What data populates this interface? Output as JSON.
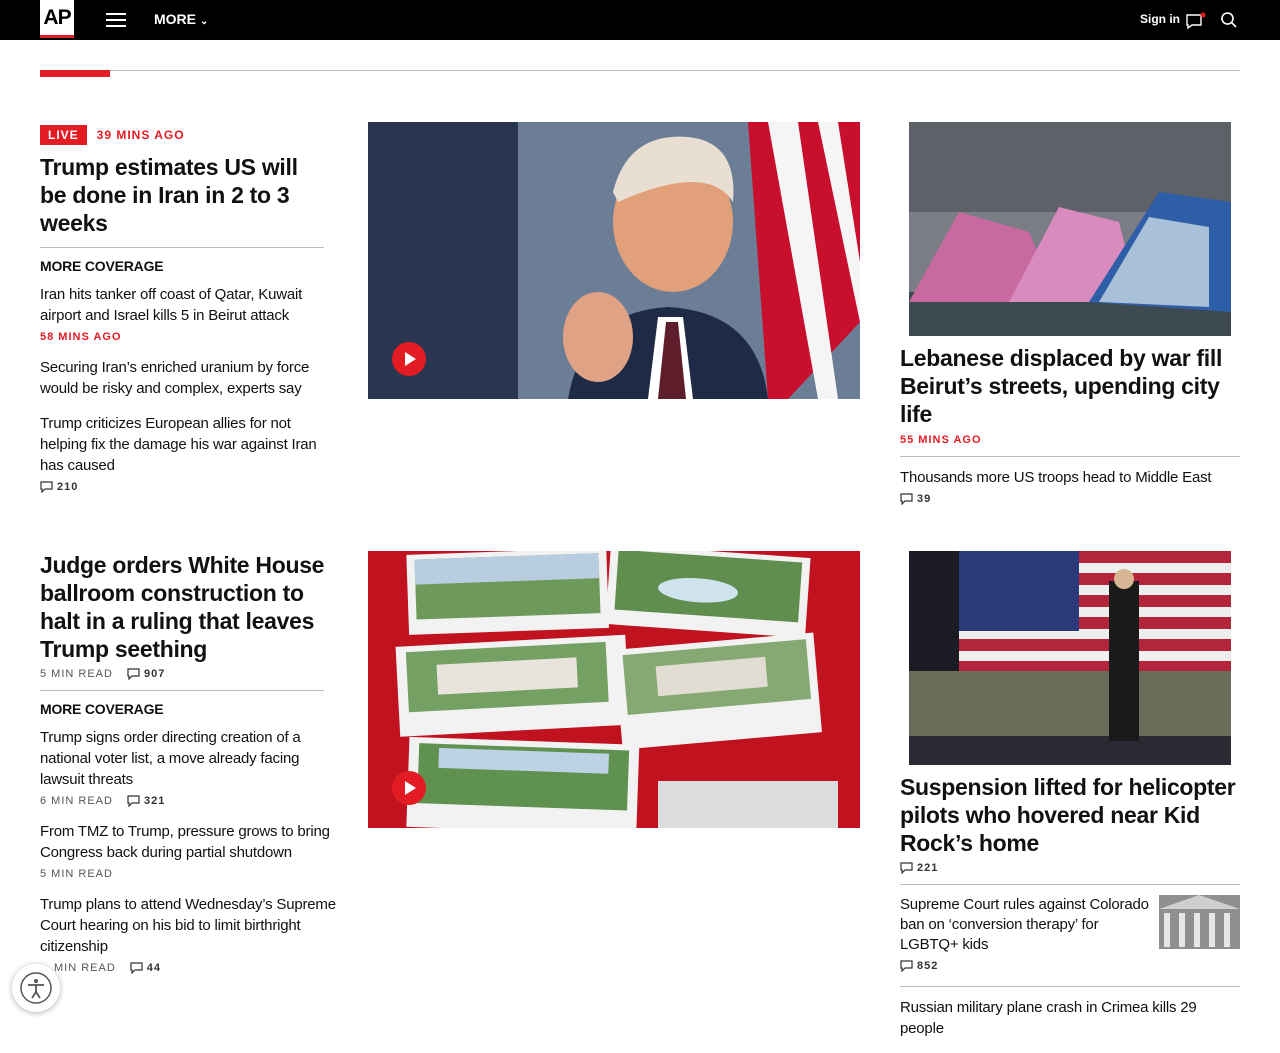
{
  "header": {
    "logo": "AP",
    "more_label": "MORE",
    "signin_label": "Sign in"
  },
  "section1": {
    "left": {
      "live_badge": "LIVE",
      "timestamp": "39 MINS AGO",
      "headline": "Trump estimates US will be done in Iran in 2 to 3 weeks",
      "more_coverage_label": "MORE COVERAGE",
      "items": [
        {
          "headline": "Iran hits tanker off coast of Qatar, Kuwait airport and Israel kills 5 in Beirut attack",
          "timestamp": "58 MINS AGO"
        },
        {
          "headline": "Securing Iran’s enriched uranium by force would be risky and complex, experts say"
        },
        {
          "headline": "Trump criticizes European allies for not helping fix the damage his war against Iran has caused",
          "comments": "210"
        }
      ]
    },
    "right": {
      "headline": "Lebanese displaced by war fill Beirut’s streets, upending city life",
      "timestamp": "55 MINS AGO",
      "items": [
        {
          "headline": "Thousands more US troops head to Middle East",
          "comments": "39"
        }
      ]
    }
  },
  "section2": {
    "left": {
      "headline": "Judge orders White House ballroom construction to halt in a ruling that leaves Trump seething",
      "read_time": "5 MIN READ",
      "comments": "907",
      "more_coverage_label": "MORE COVERAGE",
      "items": [
        {
          "headline": "Trump signs order directing creation of a national voter list, a move already facing lawsuit threats",
          "read_time": "6 MIN READ",
          "comments": "321"
        },
        {
          "headline": "From TMZ to Trump, pressure grows to bring Congress back during partial shutdown",
          "read_time": "5 MIN READ"
        },
        {
          "headline": "Trump plans to attend Wednesday’s Supreme Court hearing on his bid to limit birthright citizenship",
          "read_time": "MIN READ",
          "comments": "44"
        }
      ]
    },
    "right": {
      "headline": "Suspension lifted for helicopter pilots who hovered near Kid Rock’s home",
      "comments": "221",
      "items": [
        {
          "headline": "Supreme Court rules against Colorado ban on ‘conversion therapy’ for LGBTQ+ kids",
          "comments": "852"
        },
        {
          "headline": "Russian military plane crash in Crimea kills 29 people"
        }
      ]
    }
  },
  "icons": [
    "hamburger-icon",
    "chevron-down-icon",
    "message-icon",
    "search-icon",
    "comment-icon",
    "play-icon",
    "accessibility-icon"
  ],
  "colors": {
    "accent": "#e31b23",
    "topbar": "#000000"
  }
}
